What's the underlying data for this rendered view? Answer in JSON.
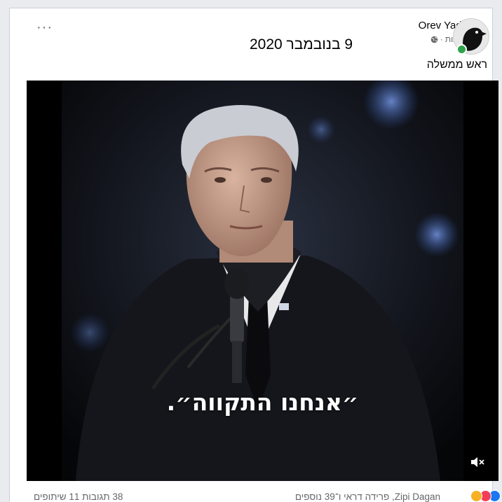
{
  "post": {
    "more_label": "···",
    "date_text": "9 בנובמבר 2020",
    "author": "Orev Yadar",
    "time_text": "6 שעות",
    "dot": "·",
    "caption": "ראש ממשלה",
    "subtitle": "״אנחנו התקווה״.",
    "reactors_text": "Zipi Dagan, פרידה דראי ו־39 נוספים",
    "counts_text": "38 תגובות 11 שיתופים",
    "icons": [
      "more-icon",
      "globe-icon",
      "avatar-crow-icon",
      "volume-muted-icon",
      "like-reaction-icon",
      "love-reaction-icon",
      "haha-reaction-icon"
    ]
  }
}
